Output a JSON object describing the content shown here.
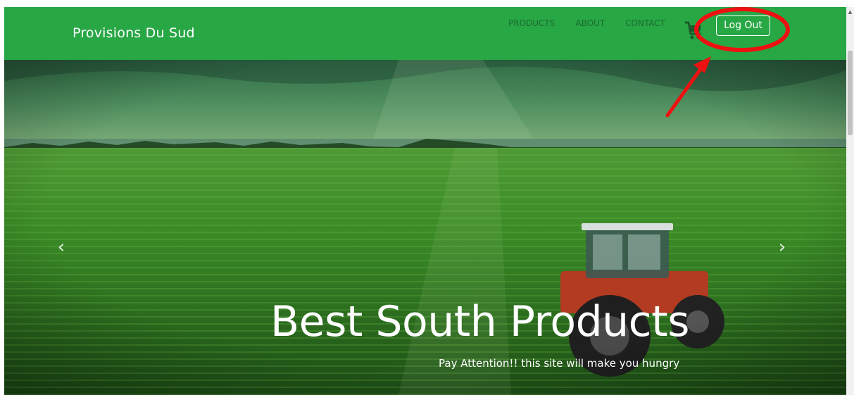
{
  "navbar": {
    "brand": "Provisions Du Sud",
    "links": [
      "PRODUCTS",
      "ABOUT",
      "CONTACT"
    ],
    "cart_icon": "shopping-cart-icon",
    "logout_label": "Log Out"
  },
  "hero": {
    "title": "Best South Products",
    "subtitle": "Pay Attention!! this site will make you hungry",
    "prev_glyph": "‹",
    "next_glyph": "›"
  },
  "annotation": {
    "color": "#ee1111",
    "shapes": [
      "ellipse",
      "arrow"
    ]
  },
  "colors": {
    "navbar": "#28a745",
    "nav_link": "#1b6b2f",
    "white": "#ffffff"
  },
  "scrollbar": {
    "up_glyph": "▲"
  }
}
